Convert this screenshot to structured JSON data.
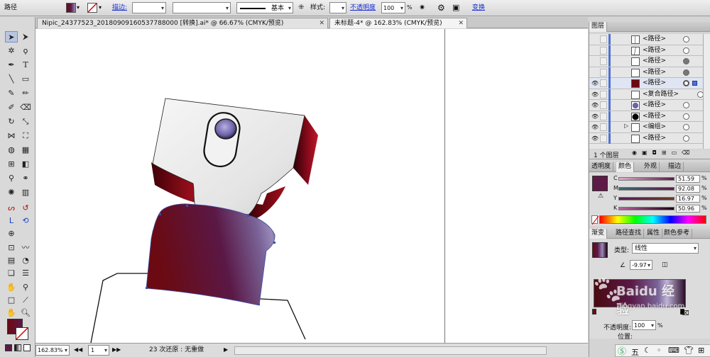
{
  "control_bar": {
    "object_type": "路径",
    "stroke_label": "描边:",
    "brush_label": "基本",
    "style_label": "样式:",
    "opacity_label": "不透明度",
    "opacity_value": "100",
    "opacity_unit": "%",
    "transform_label": "变换"
  },
  "tabs": [
    {
      "label": "Nipic_24377523_20180909160537788000  [转换].ai* @ 66.67% (CMYK/预览)"
    },
    {
      "label": "未标题-4* @ 162.83% (CMYK/预览)"
    }
  ],
  "status_bar": {
    "zoom": "162.83%",
    "artboard": "1",
    "history": "23 次还原 : 无重做"
  },
  "layers_panel": {
    "title": "图层",
    "rows": [
      {
        "name": "<路径>",
        "eye": false,
        "target": "empty"
      },
      {
        "name": "<路径>",
        "eye": false,
        "target": "empty"
      },
      {
        "name": "<路径>",
        "eye": false,
        "target": "filled"
      },
      {
        "name": "<路径>",
        "eye": false,
        "target": "filled"
      },
      {
        "name": "<路径>",
        "eye": true,
        "target": "selected"
      },
      {
        "name": "<复合路径>",
        "eye": true,
        "target": "empty"
      },
      {
        "name": "<路径>",
        "eye": true,
        "target": "empty"
      },
      {
        "name": "<路径>",
        "eye": true,
        "target": "empty"
      },
      {
        "name": "<编组>",
        "eye": true,
        "target": "empty"
      },
      {
        "name": "<路径>",
        "eye": true,
        "target": "empty"
      }
    ],
    "footer": "1 个图层"
  },
  "color_panel": {
    "tabs": [
      "透明度",
      "颜色",
      "外观",
      "描边"
    ],
    "active_tab": "颜色",
    "channels": [
      {
        "label": "C",
        "value": "51.59",
        "ratio": 0.5159
      },
      {
        "label": "M",
        "value": "92.08",
        "ratio": 0.9208
      },
      {
        "label": "Y",
        "value": "16.97",
        "ratio": 0.1697
      },
      {
        "label": "K",
        "value": "50.96",
        "ratio": 0.5096
      }
    ],
    "unit": "%",
    "swatch_color": "#5e1a47"
  },
  "gradient_panel": {
    "tabs": [
      "渐变",
      "路径查找",
      "属性",
      "颜色参考"
    ],
    "type_label": "类型:",
    "type_value": "线性",
    "angle": "-9.97",
    "opacity_label": "不透明度:",
    "opacity_value": "100",
    "location_label": "位置:",
    "unit": "%"
  },
  "watermark": {
    "brand": "Baidu 经验",
    "url": "jingyan.baidu.com"
  },
  "taskbar": {
    "ime": "五"
  },
  "colors": {
    "accent_link": "#1a2fd0",
    "gradient_dark_red": "#6b0a12",
    "gradient_plum": "#5a1846",
    "gradient_lilac": "#9a8ab8",
    "layer_bar": "#4c72d6"
  }
}
